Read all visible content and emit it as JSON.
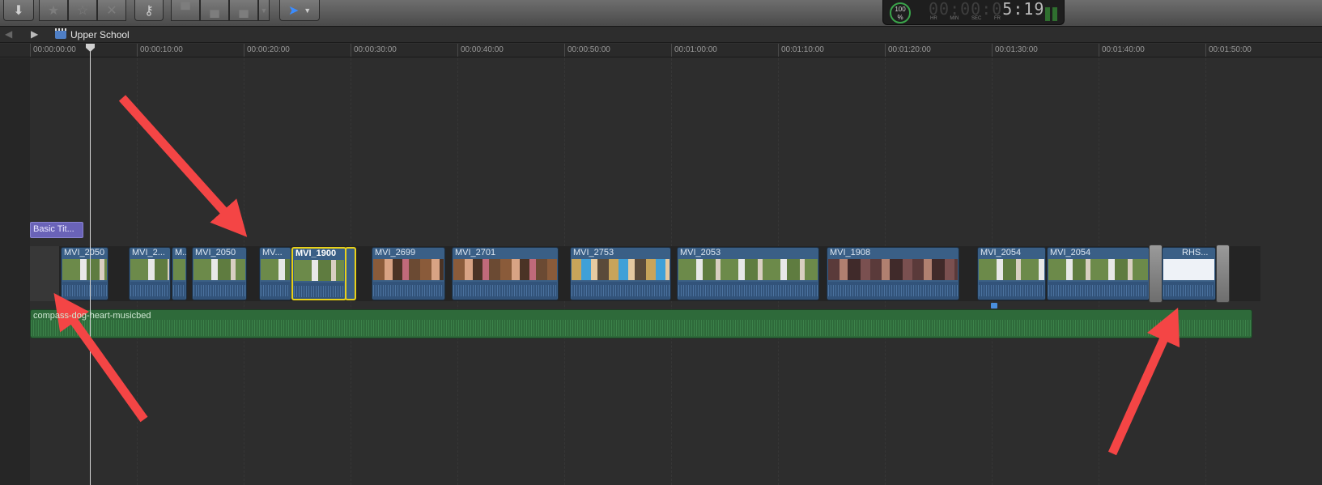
{
  "toolbar": {
    "icons": [
      "import-arrow-icon",
      "favorite-star-icon",
      "unrate-star-icon",
      "reject-x-icon",
      "keyword-icon",
      "connect-clip-icon",
      "insert-clip-icon",
      "append-clip-icon",
      "select-tool-icon"
    ],
    "zoom_gauge": "100\n%",
    "timecode_dim": "00:00:0",
    "timecode_lit": "5:19",
    "timecode_labels": "HR MIN SEC FR"
  },
  "nav": {
    "project_name": "Upper School"
  },
  "ruler": {
    "ticks": [
      "00:00:00:00",
      "00:00:10:00",
      "00:00:20:00",
      "00:00:30:00",
      "00:00:40:00",
      "00:00:50:00",
      "00:01:00:00",
      "00:01:10:00",
      "00:01:20:00",
      "00:01:30:00",
      "00:01:40:00",
      "00:01:50:00"
    ]
  },
  "timeline": {
    "title_clip": "Basic Tit...",
    "clips": [
      "MVI_2050",
      "MVI_2...",
      "M...",
      "MVI_2050",
      "MV...",
      "MVI_1900",
      "MVI_2699",
      "MVI_2701",
      "MVI_2753",
      "MVI_2053",
      "MVI_1908",
      "MVI_2054",
      "MVI_2054",
      "RHS..."
    ],
    "music_clip": "compass-dog-heart-musicbed"
  },
  "colors": {
    "annotation_arrow": "#f44545",
    "selection": "#e8d11a",
    "video_clip": "#3a5f86",
    "audio_clip": "#2e6a3a",
    "title_clip": "#6a63b8"
  }
}
